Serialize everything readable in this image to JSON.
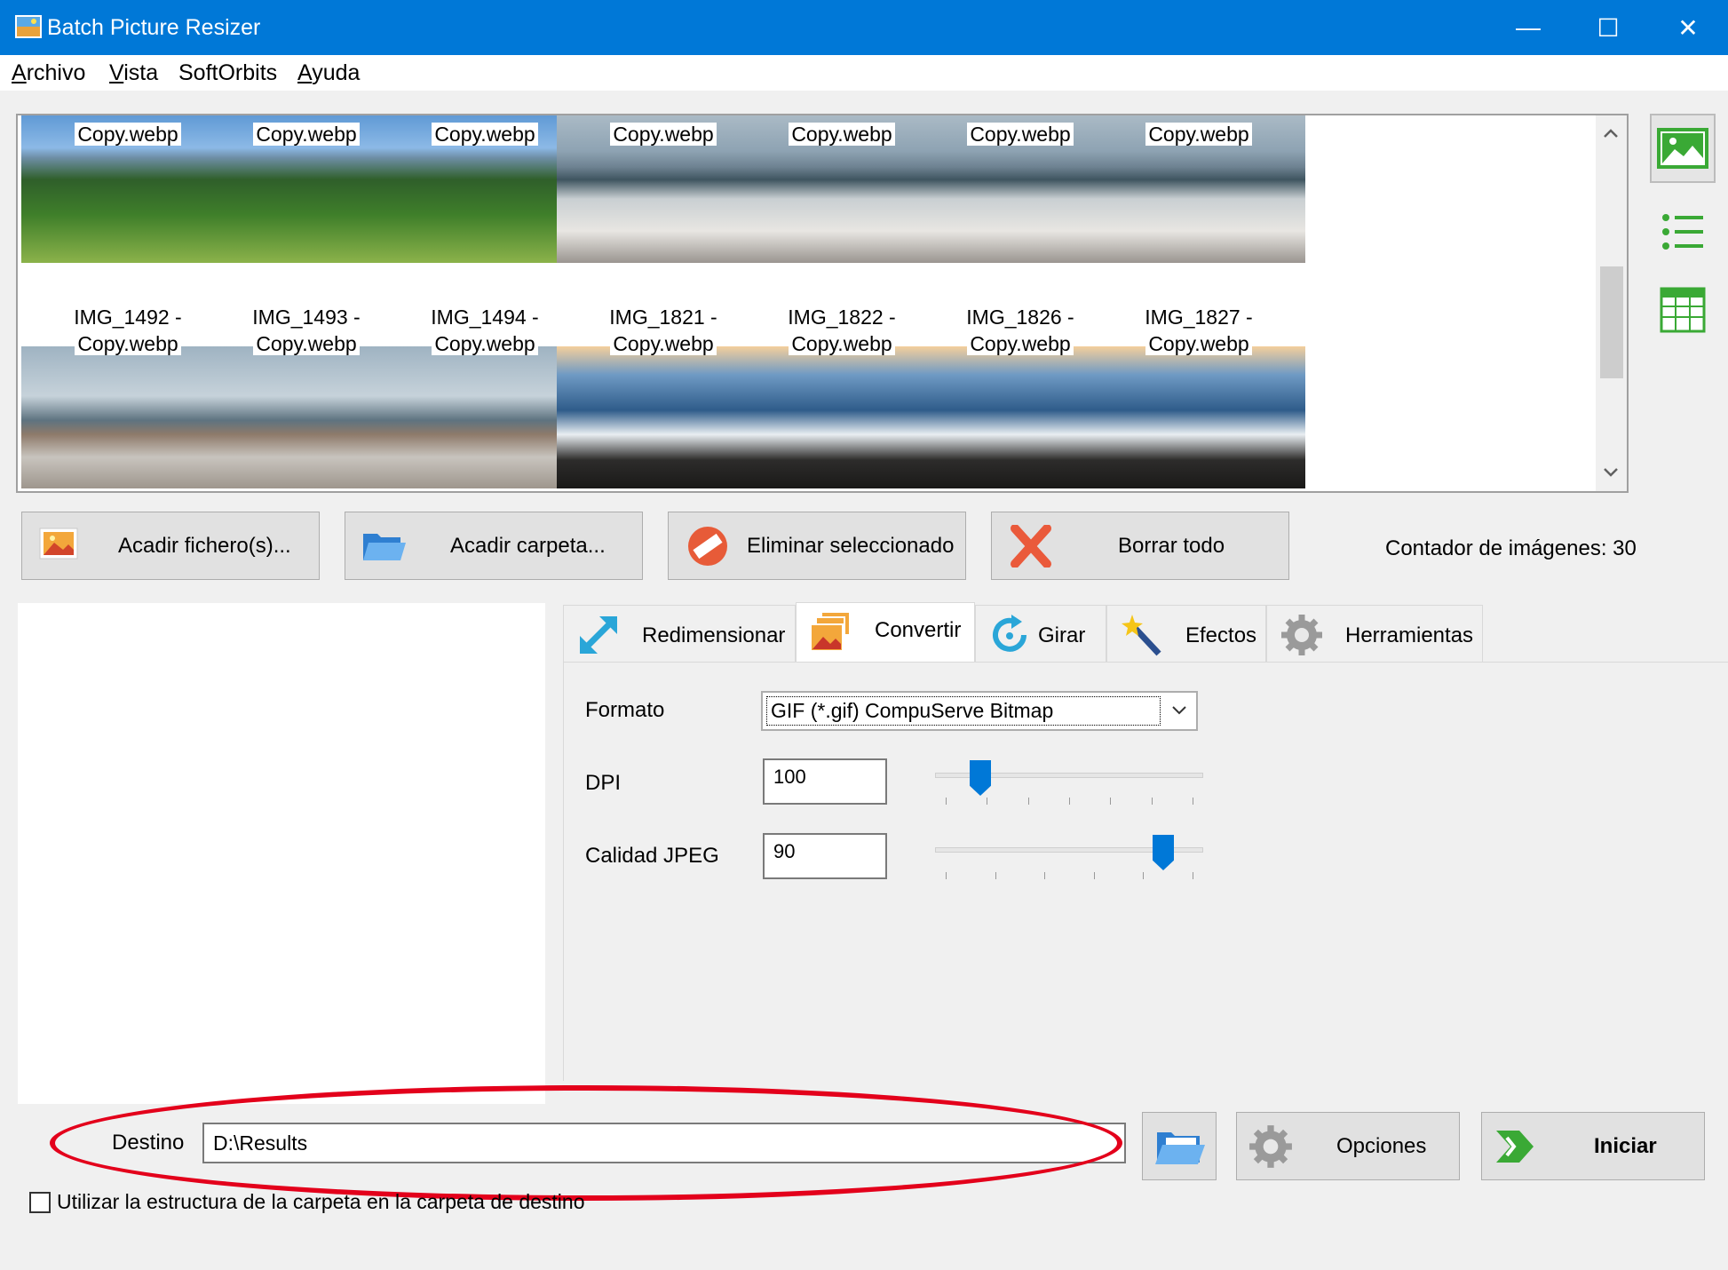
{
  "window": {
    "title": "Batch Picture Resizer",
    "minimize_glyph": "—",
    "maximize_glyph": "☐",
    "close_glyph": "✕"
  },
  "menu": {
    "items": [
      {
        "first": "A",
        "rest": "rchivo"
      },
      {
        "first": "V",
        "rest": "ista"
      },
      {
        "first": "",
        "rest": "SoftOrbits"
      },
      {
        "first": "A",
        "rest": "yuda"
      }
    ]
  },
  "gallery": {
    "top_row_captions": [
      "Copy.webp",
      "Copy.webp",
      "Copy.webp",
      "Copy.webp",
      "Copy.webp",
      "Copy.webp",
      "Copy.webp"
    ],
    "second_row": [
      {
        "line1": "IMG_1492 -",
        "line2": "Copy.webp",
        "scene": "beach"
      },
      {
        "line1": "IMG_1493 -",
        "line2": "Copy.webp",
        "scene": "beach"
      },
      {
        "line1": "IMG_1494 -",
        "line2": "Copy.webp",
        "scene": "beach"
      },
      {
        "line1": "IMG_1821 -",
        "line2": "Copy.webp",
        "scene": "rocks"
      },
      {
        "line1": "IMG_1822 -",
        "line2": "Copy.webp",
        "scene": "rocks"
      },
      {
        "line1": "IMG_1826 -",
        "line2": "Copy.webp",
        "scene": "rocks"
      },
      {
        "line1": "IMG_1827 -",
        "line2": "Copy.webp",
        "scene": "rocks"
      }
    ],
    "top_row_scenes": [
      "mountain",
      "mountain",
      "mountain",
      "sea",
      "sea",
      "sea",
      "sea"
    ]
  },
  "toolbar": {
    "add_files": "Acadir fichero(s)...",
    "add_folder": "Acadir carpeta...",
    "remove_selected": "Eliminar seleccionado",
    "clear_all": "Borrar todo",
    "counter": "Contador de imágenes: 30"
  },
  "tabs": {
    "resize": "Redimensionar",
    "convert": "Convertir",
    "rotate": "Girar",
    "effects": "Efectos",
    "tools": "Herramientas"
  },
  "convert": {
    "format_label": "Formato",
    "format_value": "GIF (*.gif) CompuServe Bitmap",
    "dpi_label": "DPI",
    "dpi_value": "100",
    "jpeg_label": "Calidad JPEG",
    "jpeg_value": "90",
    "dpi_slider_fraction": 0.14,
    "jpeg_slider_fraction": 0.88
  },
  "bottom": {
    "destino_label": "Destino",
    "destino_value": "D:\\Results",
    "options_label": "Opciones",
    "start_label": "Iniciar",
    "folder_structure_label": "Utilizar la estructura de la carpeta en la carpeta de destino",
    "folder_structure_checked": false
  },
  "colors": {
    "titlebar": "#0078d7",
    "highlight_ellipse": "#e3001b",
    "accent_green": "#3aa935"
  }
}
